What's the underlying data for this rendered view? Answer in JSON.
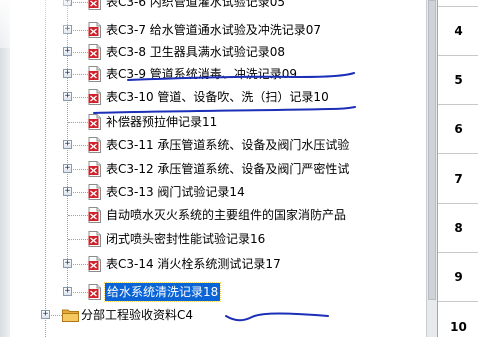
{
  "tree": {
    "items": [
      {
        "label": "表C3-6 内织管道灌水试验记录05"
      },
      {
        "label": "表C3-7 给水管道通水试验及冲洗记录07"
      },
      {
        "label": "表C3-8 卫生器具满水试验记录08"
      },
      {
        "label": "表C3-9 管道系统消毒、冲洗记录09"
      },
      {
        "label": "表C3-10 管道、设备吹、洗（扫）记录10"
      },
      {
        "label": "补偿器预拉伸记录11"
      },
      {
        "label": "表C3-11 承压管道系统、设备及阀门水压试验"
      },
      {
        "label": "表C3-12 承压管道系统、设备及阀门严密性试"
      },
      {
        "label": "表C3-13 阀门试验记录14"
      },
      {
        "label": "自动喷水灭火系统的主要组件的国家消防产品"
      },
      {
        "label": "闭式喷头密封性能试验记录16"
      },
      {
        "label": "表C3-14 消火栓系统测试记录17"
      },
      {
        "label": "给水系统清洗记录18"
      },
      {
        "label": "分部工程验收资料C4"
      }
    ]
  },
  "number_column": [
    "4",
    "5",
    "6",
    "7",
    "8",
    "9",
    "10"
  ],
  "colors": {
    "selection": "#0a64d6",
    "annotation_ink": "#1b2fb8",
    "pdf_red": "#d0202a"
  }
}
